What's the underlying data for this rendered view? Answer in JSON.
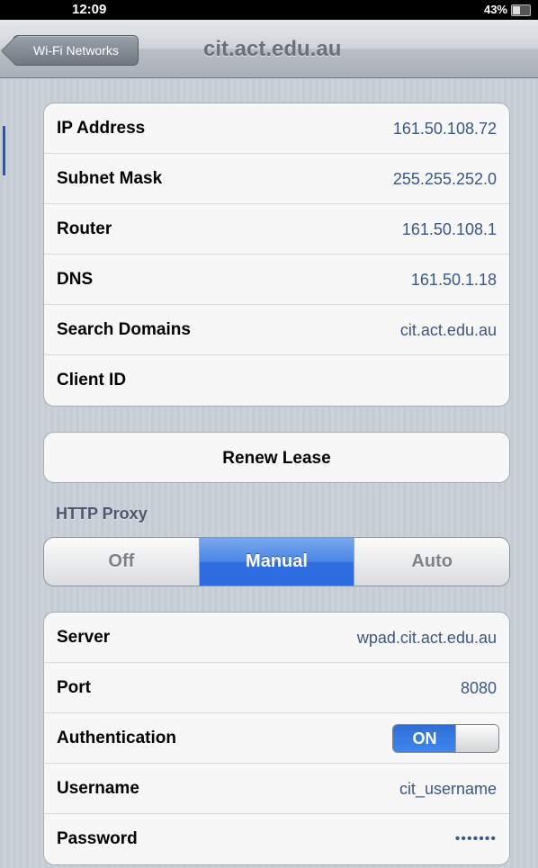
{
  "status_bar": {
    "time": "12:09",
    "battery": "43%"
  },
  "nav": {
    "back_label": "Wi-Fi Networks",
    "title": "cit.act.edu.au"
  },
  "network_info": [
    {
      "label": "IP Address",
      "value": "161.50.108.72"
    },
    {
      "label": "Subnet Mask",
      "value": "255.255.252.0"
    },
    {
      "label": "Router",
      "value": "161.50.108.1"
    },
    {
      "label": "DNS",
      "value": "161.50.1.18"
    },
    {
      "label": "Search Domains",
      "value": "cit.act.edu.au"
    },
    {
      "label": "Client ID",
      "value": ""
    }
  ],
  "renew_lease_label": "Renew Lease",
  "http_proxy": {
    "header": "HTTP Proxy",
    "segments": [
      "Off",
      "Manual",
      "Auto"
    ],
    "selected": "Manual"
  },
  "proxy_settings": {
    "server": {
      "label": "Server",
      "value": "wpad.cit.act.edu.au"
    },
    "port": {
      "label": "Port",
      "value": "8080"
    },
    "authentication": {
      "label": "Authentication",
      "state": "ON"
    },
    "username": {
      "label": "Username",
      "value": "cit_username"
    },
    "password": {
      "label": "Password",
      "value": "•••••••"
    }
  },
  "colors": {
    "value_text": "#3b5785",
    "selected_segment": "#2e6ee0",
    "background": "#c5ccd4"
  }
}
